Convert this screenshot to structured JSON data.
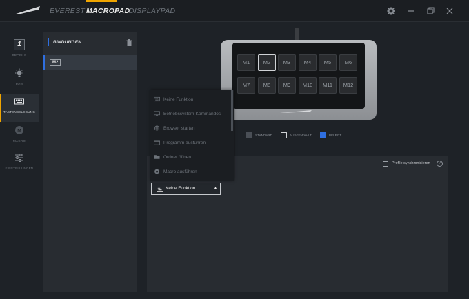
{
  "nav": {
    "tabs": [
      {
        "label": "EVEREST"
      },
      {
        "label": "MACROPAD"
      },
      {
        "label": "DISPLAYPAD"
      }
    ],
    "active_tab": "MACROPAD",
    "accent_color": "#f0a500"
  },
  "sidebar": {
    "profile_number": "1",
    "items": [
      {
        "label": "PROFILE",
        "icon": "profile-icon"
      },
      {
        "label": "RGB",
        "icon": "light-bulb-icon"
      },
      {
        "label": "TASTENBELEGUNG",
        "icon": "keyboard-icon",
        "active": true
      },
      {
        "label": "MACRO",
        "icon": "macro-icon"
      },
      {
        "label": "EINSTELLUNGEN",
        "icon": "sliders-icon"
      }
    ]
  },
  "bindings": {
    "title": "BINDUNGEN",
    "rows": [
      {
        "tag": "M2"
      }
    ]
  },
  "device": {
    "keys": [
      "M1",
      "M2",
      "M3",
      "M4",
      "M5",
      "M6",
      "M7",
      "M8",
      "M9",
      "M10",
      "M11",
      "M12"
    ],
    "selected_key": "M2"
  },
  "legend": {
    "standard": "STANDARD",
    "selected": "AUSGEWÄHLT",
    "assigned": "BELEGT",
    "assigned_color": "#2f6fe0"
  },
  "sync": {
    "label": "Profile synchronisieren",
    "help": "?"
  },
  "dropdown": {
    "selected": "Keine Funktion",
    "options": [
      {
        "label": "Keine Funktion",
        "icon": "keyboard-icon"
      },
      {
        "label": "Betriebssystem-Kommandos",
        "icon": "monitor-icon"
      },
      {
        "label": "Browser starten",
        "icon": "globe-icon"
      },
      {
        "label": "Programm ausführen",
        "icon": "window-icon"
      },
      {
        "label": "Ordner öffnen",
        "icon": "folder-icon"
      },
      {
        "label": "Macro ausführen",
        "icon": "macro-icon"
      }
    ]
  }
}
